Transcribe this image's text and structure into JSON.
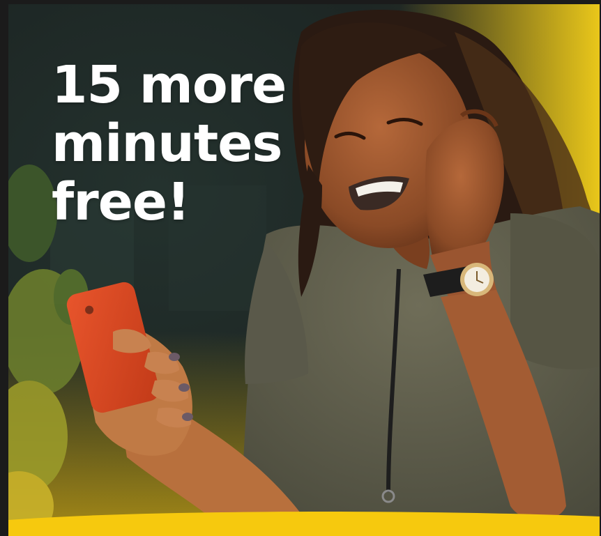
{
  "headline": {
    "line1": "15 more",
    "line2": "minutes",
    "line3": "free!"
  },
  "colors": {
    "frame": "#1b1b1b",
    "brand_yellow": "#f6c90e",
    "background_dark": "#1e2a27",
    "headline_text": "#ffffff"
  },
  "icons": [
    "phone-icon",
    "watch-icon"
  ]
}
